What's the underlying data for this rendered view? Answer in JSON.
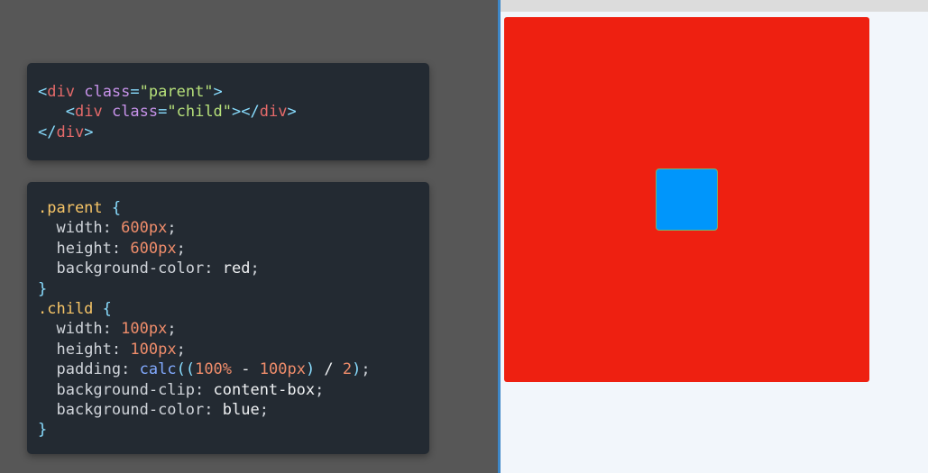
{
  "html_card": {
    "line1": {
      "open": "<",
      "tag": "div",
      "sp": " ",
      "attr": "class",
      "eq": "=",
      "val": "\"parent\"",
      "close": ">"
    },
    "line2": {
      "indent": "   ",
      "open": "<",
      "tag": "div",
      "sp": " ",
      "attr": "class",
      "eq": "=",
      "val": "\"child\"",
      "close": "></",
      "tag2": "div",
      "close2": ">"
    },
    "line3": {
      "open": "</",
      "tag": "div",
      "close": ">"
    }
  },
  "css_card": {
    "parent_selector": ".parent",
    "child_selector": ".child",
    "open_brace": " {",
    "close_brace": "}",
    "colon": ":",
    "semicolon": ";",
    "indent": "  ",
    "parent_rules": [
      {
        "prop": "width",
        "value": "600px"
      },
      {
        "prop": "height",
        "value": "600px"
      },
      {
        "prop": "background-color",
        "value": "red"
      }
    ],
    "child_rules": [
      {
        "prop": "width",
        "value": "100px"
      },
      {
        "prop": "height",
        "value": "100px"
      },
      {
        "prop": "padding",
        "fn": "calc",
        "paren_open": "((",
        "num1": "100%",
        "minus": " - ",
        "num2": "100px",
        "paren_close": ")",
        "divide": " / ",
        "num3": "2",
        "paren_end": ")"
      },
      {
        "prop": "background-clip",
        "value": "content-box"
      },
      {
        "prop": "background-color",
        "value": "blue"
      }
    ]
  },
  "preview": {
    "parent_color": "#ee2011",
    "child_color": "#0096fb"
  },
  "colors": {
    "code_bg": "#232a32",
    "divider": "#3d87c8"
  }
}
